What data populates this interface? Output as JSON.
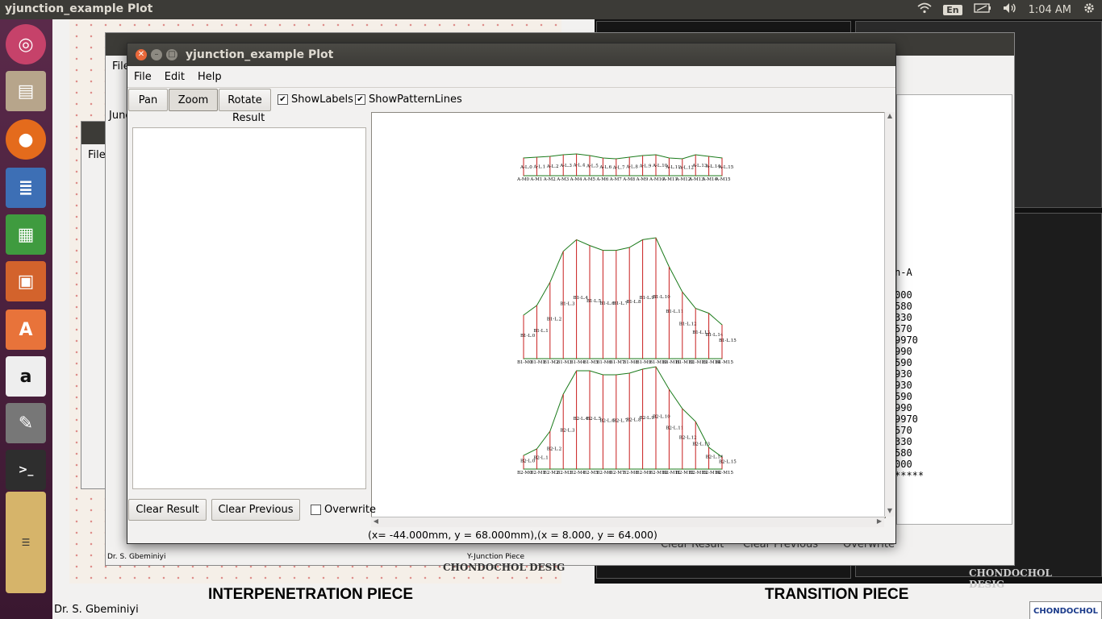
{
  "topbar": {
    "title": "yjunction_example Plot",
    "lang": "En",
    "time": "1:04 AM"
  },
  "window": {
    "title": "yjunction_example Plot",
    "menu": [
      "File",
      "Edit",
      "Help"
    ],
    "toolbar": {
      "pan": "Pan",
      "zoom": "Zoom",
      "rotate": "Rotate",
      "show_labels": "ShowLabels",
      "show_pattern_lines": "ShowPatternLines"
    },
    "result_label": "Result",
    "buttons": {
      "clear_result": "Clear Result",
      "clear_previous": "Clear Previous",
      "overwrite": "Overwrite"
    },
    "coords": "(x= -44.000mm, y = 68.000mm),(x = 8.000, y = 64.000)"
  },
  "background": {
    "left_caption": "INTERPENETRATION PIECE",
    "right_caption": "TRANSITION PIECE",
    "author": "Dr. S. Gbeminiyi",
    "author_small": "Dr. S. Gbeminiyi",
    "y_junction_piece": "Y-Junction Piece",
    "chondochol": "CHONDOCHOL DESIG",
    "logo": "CHONDOCHOL",
    "bg_file_menu": "File",
    "bg_file_menu2": "File",
    "bg_junc": "Junc",
    "bg_clear_result": "Clear Result",
    "bg_clear_previous": "Clear Previous",
    "bg_overwrite": "Overwrite",
    "right_table": "n-A\n\n000\n580\n330\n570\n9970\n990\n590\n930\n930\n590\n990\n9970\n570\n330\n580\n000\n*****"
  },
  "plot": {
    "pieces": [
      {
        "name": "A",
        "piece_label_prefix": "A-L",
        "marker_prefix": "A-M",
        "count": 16
      },
      {
        "name": "B1",
        "piece_label_prefix": "B1-L",
        "marker_prefix": "B1-M",
        "count": 16
      },
      {
        "name": "B2",
        "piece_label_prefix": "B2-L",
        "marker_prefix": "B2-M",
        "count": 16
      }
    ],
    "colors": {
      "outline": "#1a7a1a",
      "lines": "#c81e1e",
      "labels": "#000000"
    }
  }
}
